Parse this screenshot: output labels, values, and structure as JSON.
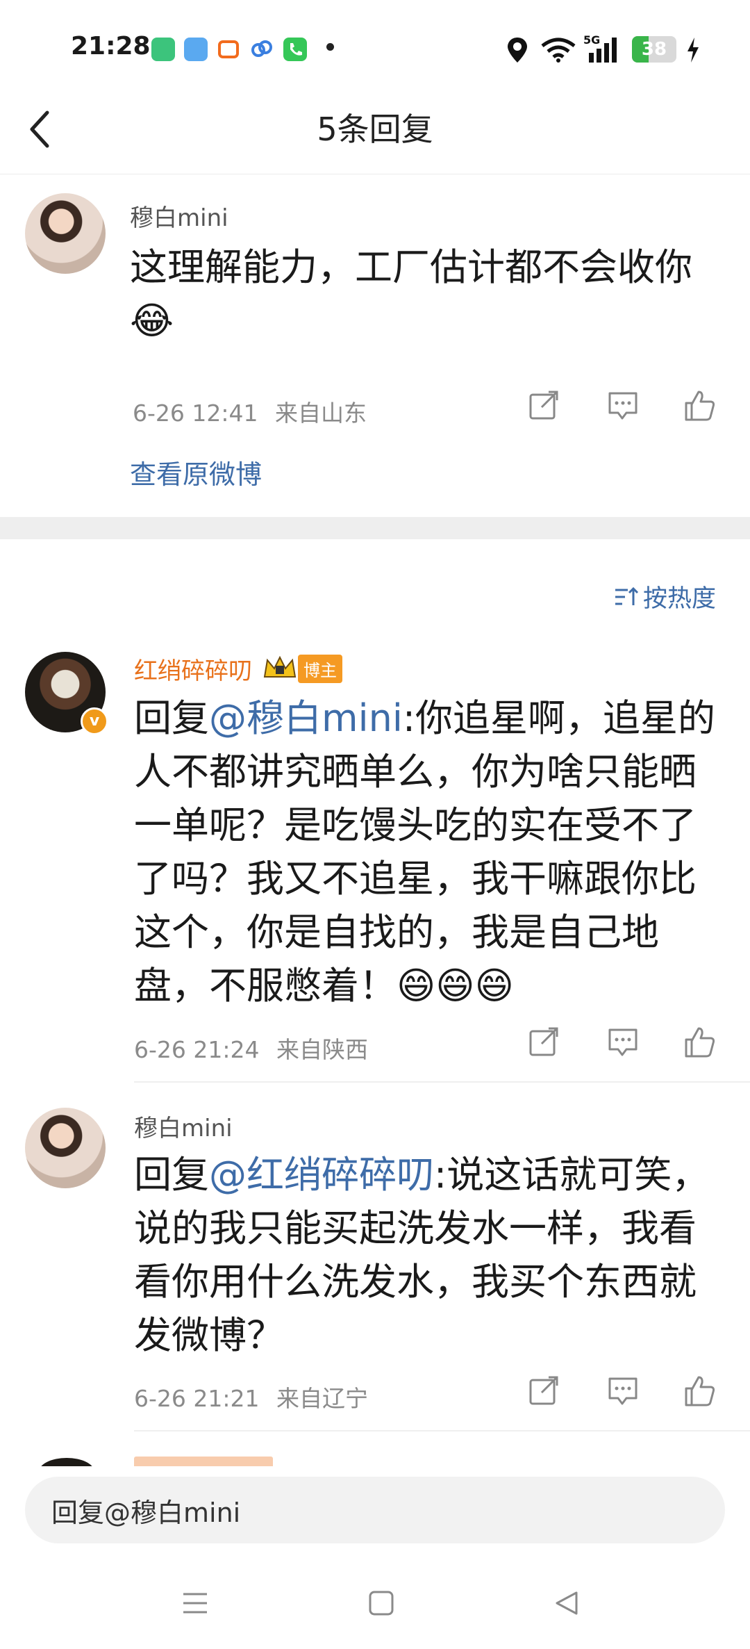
{
  "status_bar": {
    "time": "21:28",
    "network": "5G",
    "battery": 38,
    "icons": [
      "green-app-icon",
      "weather-icon",
      "taobao-icon",
      "baidu-pan-icon",
      "phone-icon",
      "location-icon",
      "wifi-icon",
      "signal-icon",
      "charging-icon"
    ]
  },
  "header": {
    "back_icon": "back-chevron-icon",
    "title": "5条回复"
  },
  "main_post": {
    "username": "穆白mini",
    "text": "这理解能力，工厂估计都不会收你😂",
    "time": "6-26 12:41",
    "location": "来自山东",
    "view_original": "查看原微博"
  },
  "sort_label": "按热度",
  "replies": [
    {
      "username": "红绡碎碎叨",
      "badge": "博主",
      "reply_prefix": "回复",
      "mention": "@穆白mini",
      "text": ":你追星啊，追星的人不都讲究晒单么，你为啥只能晒一单呢？是吃馒头吃的实在受不了了吗？我又不追星，我干嘛跟你比这个，你是自找的，我是自己地盘，不服憋着！😄😄😄",
      "time": "6-26 21:24",
      "location": "来自陕西"
    },
    {
      "username": "穆白mini",
      "reply_prefix": "回复",
      "mention": "@红绡碎碎叨",
      "text": ":说这话就可笑，说的我只能买起洗发水一样，我看看你用什么洗发水，我买个东西就发微博？",
      "time": "6-26 21:21",
      "location": "来自辽宁"
    }
  ],
  "reply_input": {
    "value": "回复@穆白mini"
  },
  "colors": {
    "link": "#3e6ca8",
    "orange": "#e8711b",
    "battery_green": "#39b54a"
  }
}
